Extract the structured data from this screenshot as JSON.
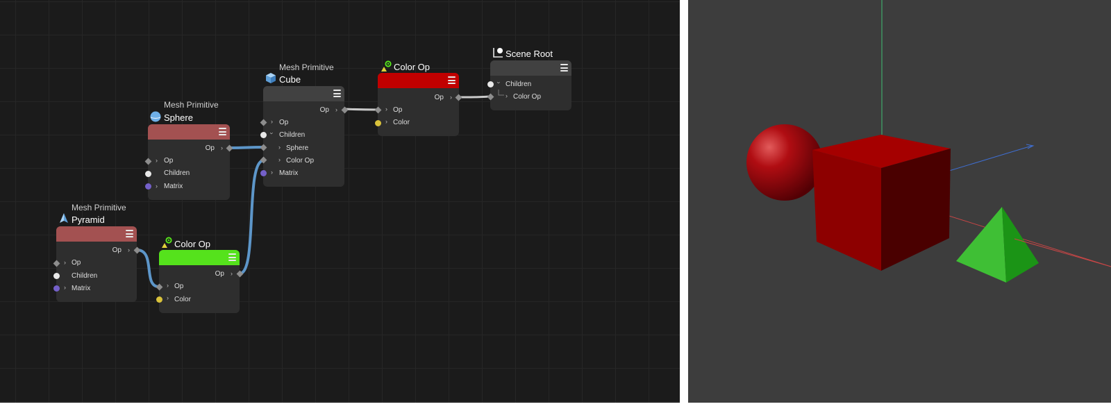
{
  "colors": {
    "canvas_bg": "#1b1b1b",
    "node_body": "#2e2e2e",
    "mesh_header": "#a35151",
    "color_op_green": "#55e21c",
    "color_op_red": "#c10000",
    "scene_root_header": "#414141",
    "wire_blue": "#5d96c9",
    "wire_gray": "#c9c9c9",
    "port_color_yellow": "#d9c23b",
    "port_matrix_purple": "#7460c9",
    "port_children_white": "#e8e8e8"
  },
  "nodes": {
    "sphere": {
      "type_label": "Mesh Primitive",
      "name": "Sphere",
      "icon": "sphere-icon",
      "output_label": "Op",
      "inputs": [
        "Op",
        "Children",
        "Matrix"
      ]
    },
    "cube": {
      "type_label": "Mesh Primitive",
      "name": "Cube",
      "icon": "cube-icon",
      "output_label": "Op",
      "inputs": [
        "Op",
        "Children",
        "Sphere",
        "Color Op",
        "Matrix"
      ]
    },
    "pyramid": {
      "type_label": "Mesh Primitive",
      "name": "Pyramid",
      "icon": "pyramid-icon",
      "output_label": "Op",
      "inputs": [
        "Op",
        "Children",
        "Matrix"
      ]
    },
    "color_op_green": {
      "name": "Color Op",
      "icon": "color-op-icon",
      "output_label": "Op",
      "inputs": [
        "Op",
        "Color"
      ]
    },
    "color_op_red": {
      "name": "Color Op",
      "icon": "color-op-icon",
      "output_label": "Op",
      "inputs": [
        "Op",
        "Color"
      ]
    },
    "scene_root": {
      "name": "Scene Root",
      "icon": "scene-root-icon",
      "inputs": [
        "Children",
        "Color Op"
      ]
    }
  },
  "viewport": {
    "objects": [
      "red-sphere",
      "red-cube",
      "green-pyramid"
    ],
    "axes": [
      "x-axis-red",
      "y-axis-green",
      "z-axis-blue"
    ]
  }
}
